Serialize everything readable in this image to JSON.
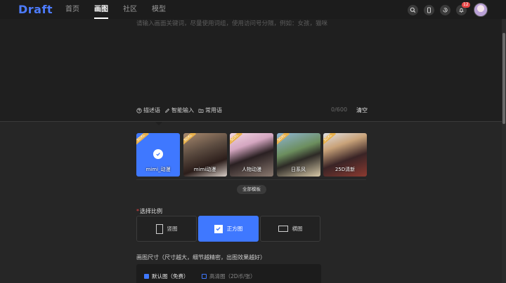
{
  "app": {
    "logo": "Draft"
  },
  "nav": [
    {
      "label": "首页",
      "active": false
    },
    {
      "label": "画图",
      "active": true
    },
    {
      "label": "社区",
      "active": false
    },
    {
      "label": "模型",
      "active": false
    }
  ],
  "header": {
    "notification_count": "12"
  },
  "prompt": {
    "placeholder": "请输入画面关键词，尽量使用词组，使用访问号分隔，例如：女孩，猫咪",
    "tools": [
      "描述语",
      "智能输入",
      "常用语"
    ],
    "counter": "0/600",
    "clear_label": "清空"
  },
  "templates": {
    "items": [
      {
        "name": "mimi_动漫",
        "tag": "SDXL",
        "selected": true
      },
      {
        "name": "mimi动漫",
        "tag": "SDXL",
        "selected": false
      },
      {
        "name": "人物动漫",
        "tag": "SDXL",
        "selected": false
      },
      {
        "name": "日系风",
        "tag": "SDXL",
        "selected": false
      },
      {
        "name": "25D清新",
        "tag": "SDXL",
        "selected": false
      }
    ],
    "all_label": "全部模板"
  },
  "ratio": {
    "label": "选择比例",
    "options": [
      {
        "label": "竖图",
        "icon": "portrait-ratio-icon",
        "selected": false
      },
      {
        "label": "正方图",
        "icon": "square-ratio-icon",
        "selected": true
      },
      {
        "label": "横图",
        "icon": "landscape-ratio-icon",
        "selected": false
      }
    ]
  },
  "size": {
    "label": "画图尺寸（尺寸越大，细节越精密，出图效果越好）",
    "options": [
      {
        "label": "默认图（免费）",
        "checked": true
      },
      {
        "label": "高清图（2D币/张）",
        "checked": false
      }
    ]
  },
  "colors": {
    "accent": "#3f78ff",
    "background": "#262626",
    "panel": "#1f1f1f"
  }
}
